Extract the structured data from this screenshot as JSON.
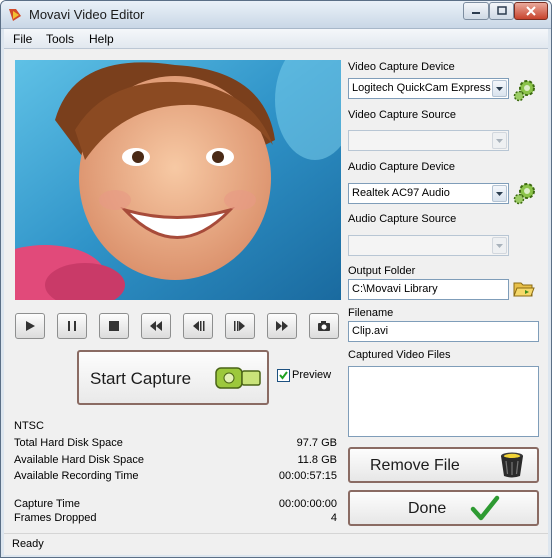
{
  "window": {
    "title": "Movavi Video Editor"
  },
  "menu": [
    "File",
    "Tools",
    "Help"
  ],
  "preview": {
    "checkbox_label": "Preview",
    "checked": true
  },
  "start_capture": {
    "label": "Start Capture"
  },
  "info": {
    "format": "NTSC",
    "rows": [
      {
        "label": "Total Hard Disk Space",
        "value": "97.7 GB"
      },
      {
        "label": "Available Hard Disk Space",
        "value": "11.8 GB"
      },
      {
        "label": "Available Recording Time",
        "value": "00:00:57:15"
      },
      {
        "label": "Capture Time",
        "value": "00:00:00:00"
      },
      {
        "label": "Frames Dropped",
        "value": "4"
      }
    ]
  },
  "settings": {
    "video_device": {
      "label": "Video Capture Device",
      "value": "Logitech QuickCam Express"
    },
    "video_source": {
      "label": "Video Capture Source",
      "value": ""
    },
    "audio_device": {
      "label": "Audio Capture Device",
      "value": "Realtek AC97 Audio"
    },
    "audio_source": {
      "label": "Audio Capture Source",
      "value": ""
    },
    "output_folder": {
      "label": "Output Folder",
      "value": "C:\\Movavi Library"
    },
    "filename": {
      "label": "Filename",
      "value": "Clip.avi"
    },
    "captured_files": {
      "label": "Captured Video Files"
    }
  },
  "buttons": {
    "remove_file": "Remove File",
    "done": "Done"
  },
  "status": "Ready",
  "colors": {
    "accent_green": "#7cb342",
    "frame": "#dde6ef"
  }
}
